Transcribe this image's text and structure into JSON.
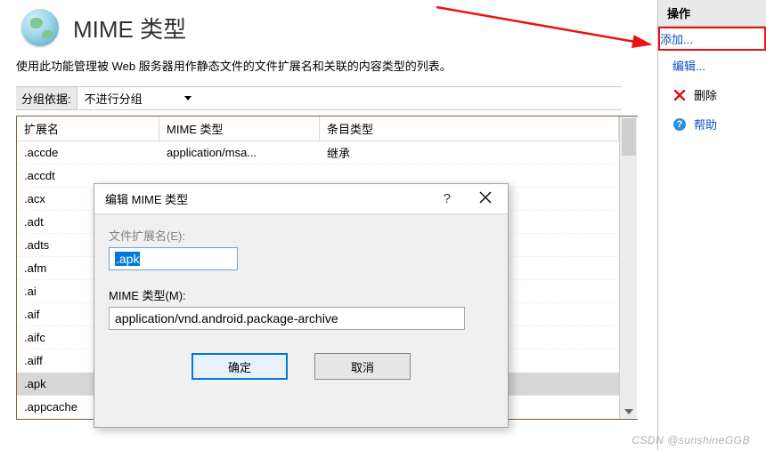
{
  "header": {
    "title": "MIME 类型"
  },
  "description": "使用此功能管理被 Web 服务器用作静态文件的文件扩展名和关联的内容类型的列表。",
  "grouping": {
    "label": "分组依据:",
    "selected": "不进行分组"
  },
  "table": {
    "headers": {
      "ext": "扩展名",
      "mime": "MIME 类型",
      "entry": "条目类型"
    },
    "rows": [
      {
        "ext": ".accde",
        "mime": "application/msa...",
        "entry": "继承",
        "selected": false
      },
      {
        "ext": ".accdt",
        "mime": "",
        "entry": "",
        "selected": false
      },
      {
        "ext": ".acx",
        "mime": "",
        "entry": "",
        "selected": false
      },
      {
        "ext": ".adt",
        "mime": "",
        "entry": "",
        "selected": false
      },
      {
        "ext": ".adts",
        "mime": "",
        "entry": "",
        "selected": false
      },
      {
        "ext": ".afm",
        "mime": "",
        "entry": "",
        "selected": false
      },
      {
        "ext": ".ai",
        "mime": "",
        "entry": "",
        "selected": false
      },
      {
        "ext": ".aif",
        "mime": "",
        "entry": "",
        "selected": false
      },
      {
        "ext": ".aifc",
        "mime": "",
        "entry": "",
        "selected": false
      },
      {
        "ext": ".aiff",
        "mime": "",
        "entry": "",
        "selected": false
      },
      {
        "ext": ".apk",
        "mime": "",
        "entry": "",
        "selected": true
      },
      {
        "ext": ".appcache",
        "mime": "",
        "entry": "",
        "selected": false
      }
    ],
    "truncated_mime": "   /",
    "truncated_entry": "继承"
  },
  "dialog": {
    "title": "编辑 MIME 类型",
    "ext_label": "文件扩展名(E):",
    "ext_value": ".apk",
    "mime_label": "MIME 类型(M):",
    "mime_value": "application/vnd.android.package-archive",
    "ok": "确定",
    "cancel": "取消"
  },
  "actions": {
    "header": "操作",
    "add": "添加...",
    "edit": "编辑...",
    "delete": "删除",
    "help": "帮助"
  },
  "watermark": "CSDN @sunshineGGB"
}
